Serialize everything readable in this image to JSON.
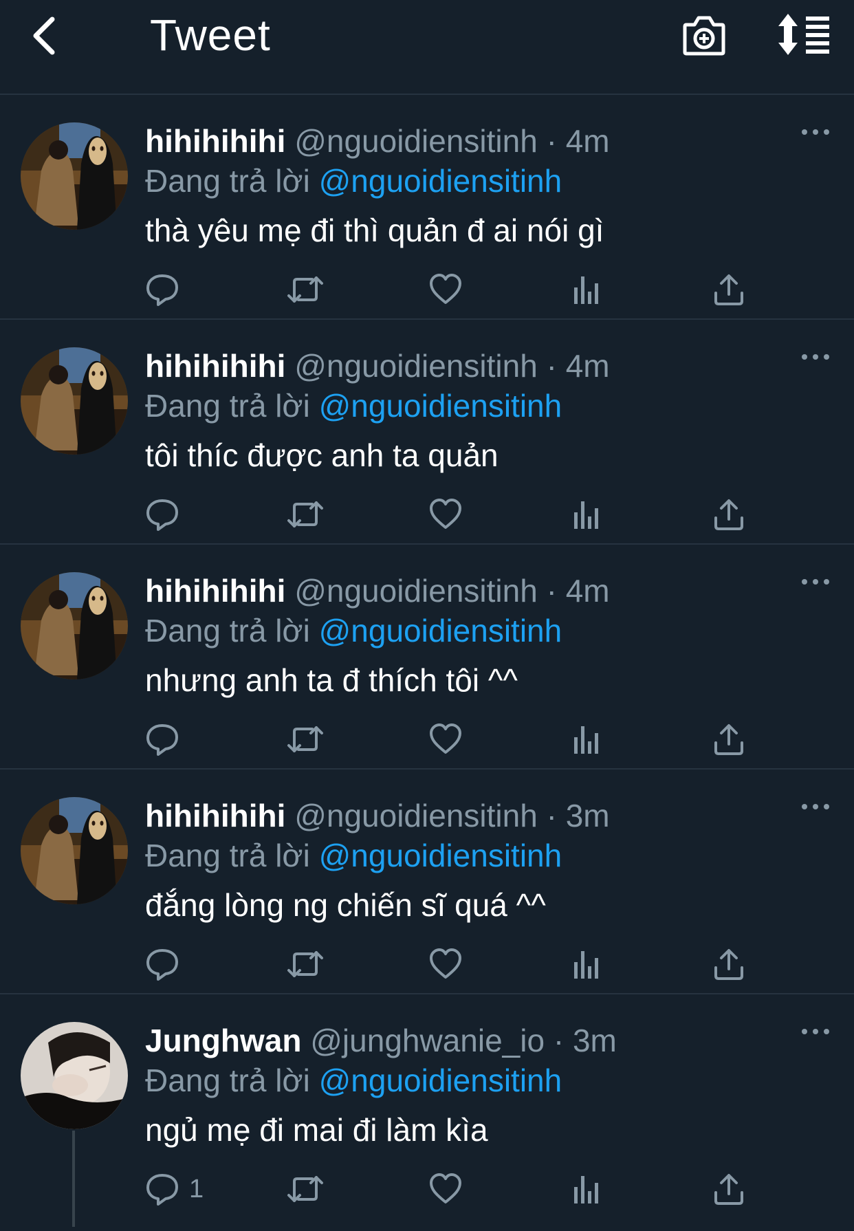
{
  "header": {
    "title": "Tweet",
    "icons": [
      "back-icon",
      "camera-plus-icon",
      "sort-icon"
    ]
  },
  "colors": {
    "background": "#15202b",
    "divider": "#263340",
    "secondary_text": "#8899a6",
    "mention": "#1da1f2"
  },
  "tweets": [
    {
      "name": "hihihihihi",
      "handle": "@nguoidiensitinh",
      "separator": "·",
      "time": "4m",
      "reply_prefix": "Đang trả lời",
      "reply_to": "@nguoidiensitinh",
      "text": "thà yêu mẹ đi thì quản đ ai nói gì",
      "reply_count": ""
    },
    {
      "name": "hihihihihi",
      "handle": "@nguoidiensitinh",
      "separator": "·",
      "time": "4m",
      "reply_prefix": "Đang trả lời",
      "reply_to": "@nguoidiensitinh",
      "text": "tôi thíc được anh ta quản",
      "reply_count": ""
    },
    {
      "name": "hihihihihi",
      "handle": "@nguoidiensitinh",
      "separator": "·",
      "time": "4m",
      "reply_prefix": "Đang trả lời",
      "reply_to": "@nguoidiensitinh",
      "text": "nhưng anh ta đ thích tôi ^^",
      "reply_count": ""
    },
    {
      "name": "hihihihihi",
      "handle": "@nguoidiensitinh",
      "separator": "·",
      "time": "3m",
      "reply_prefix": "Đang trả lời",
      "reply_to": "@nguoidiensitinh",
      "text": "đắng lòng ng chiến sĩ quá ^^",
      "reply_count": ""
    },
    {
      "name": "Junghwan",
      "handle": "@junghwanie_io",
      "separator": "·",
      "time": "3m",
      "reply_prefix": "Đang trả lời",
      "reply_to": "@nguoidiensitinh",
      "text": "ngủ mẹ đi mai đi làm kìa",
      "reply_count": "1"
    }
  ]
}
